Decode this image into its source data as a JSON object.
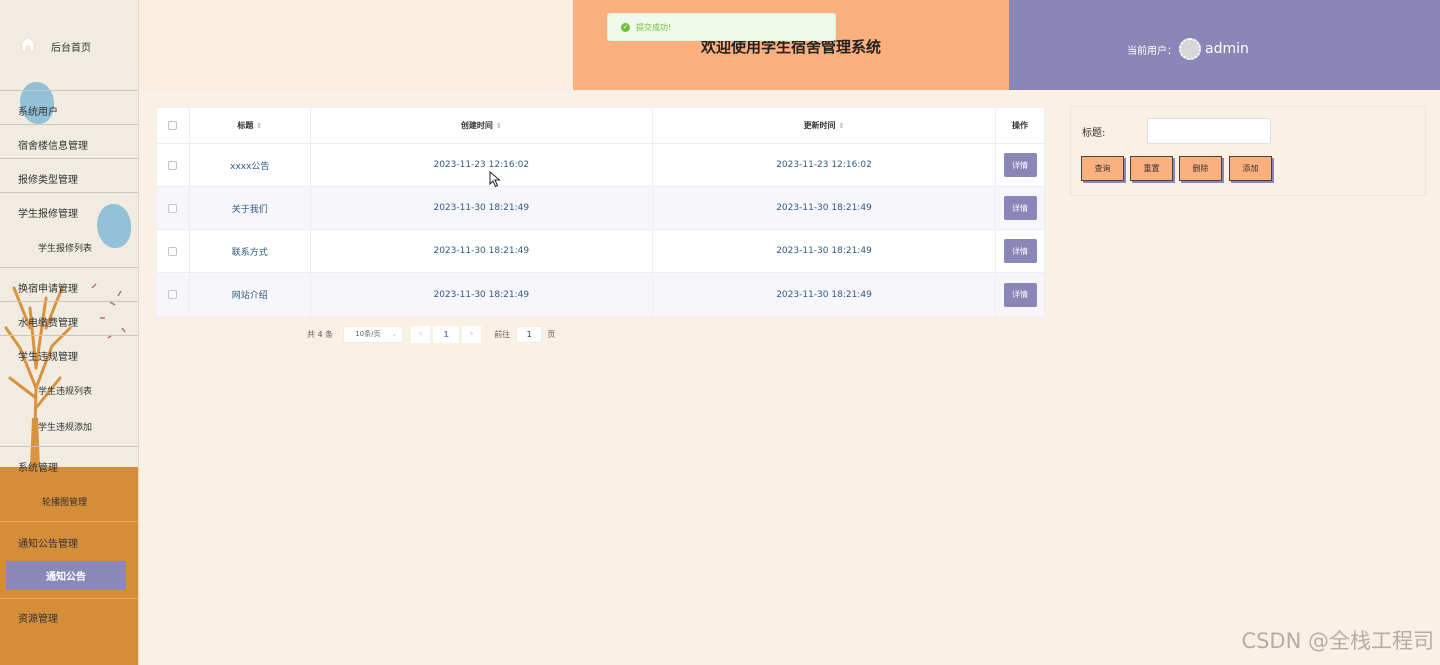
{
  "header": {
    "title": "欢迎使用学生宿舍管理系统",
    "user_label": "当前用户：",
    "username": "admin"
  },
  "toast": {
    "message": "提交成功!"
  },
  "sidebar": {
    "home": "后台首页",
    "items": [
      "系统用户",
      "宿舍楼信息管理",
      "报修类型管理",
      "学生报修管理",
      "学生报修列表",
      "换宿申请管理",
      "水电缴费管理",
      "学生违规管理",
      "学生违规列表",
      "学生违规添加",
      "系统管理",
      "轮播图管理",
      "通知公告管理",
      "通知公告",
      "资源管理"
    ]
  },
  "table": {
    "headers": {
      "title": "标题",
      "created": "创建时间",
      "updated": "更新时间",
      "op": "操作"
    },
    "rows": [
      {
        "title": "xxxx公告",
        "created": "2023-11-23 12:16:02",
        "updated": "2023-11-23 12:16:02",
        "action": "详情"
      },
      {
        "title": "关于我们",
        "created": "2023-11-30 18:21:49",
        "updated": "2023-11-30 18:21:49",
        "action": "详情"
      },
      {
        "title": "联系方式",
        "created": "2023-11-30 18:21:49",
        "updated": "2023-11-30 18:21:49",
        "action": "详情"
      },
      {
        "title": "网站介绍",
        "created": "2023-11-30 18:21:49",
        "updated": "2023-11-30 18:21:49",
        "action": "详情"
      }
    ]
  },
  "pagination": {
    "total": "共 4 条",
    "page_size": "10条/页",
    "current_page": "1",
    "goto_label": "前往",
    "goto_value": "1",
    "page_suffix": "页"
  },
  "search": {
    "label": "标题:",
    "value": "",
    "buttons": {
      "query": "查询",
      "reset": "重置",
      "delete": "删除",
      "add": "添加"
    }
  },
  "watermark": "CSDN @全栈工程司",
  "colors": {
    "accent_purple": "#8a86b8",
    "accent_orange": "#fcb07e",
    "sidebar_orange": "#d68d3a",
    "success_green": "#67c23a"
  }
}
